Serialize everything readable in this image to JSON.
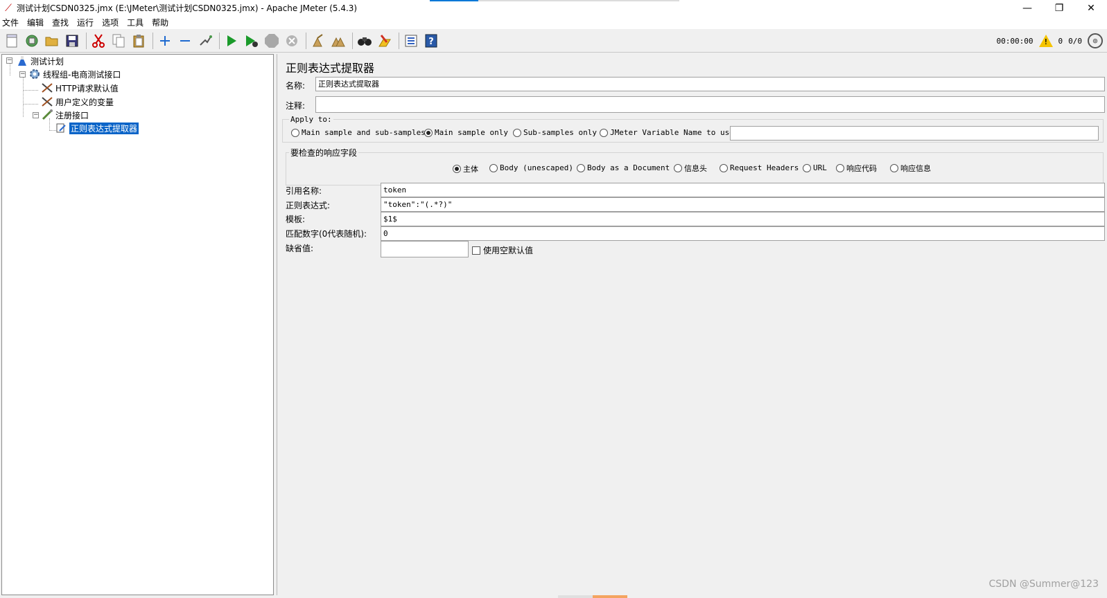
{
  "window": {
    "title": "测试计划CSDN0325.jmx (E:\\JMeter\\测试计划CSDN0325.jmx) - Apache JMeter (5.4.3)",
    "minimize": "—",
    "restore": "❐",
    "close": "✕"
  },
  "menu": [
    "文件",
    "编辑",
    "查找",
    "运行",
    "选项",
    "工具",
    "帮助"
  ],
  "toolbar": {
    "timer": "00:00:00",
    "warning_count": "0",
    "thread_ratio": "0/0",
    "buttons": [
      "new-icon",
      "templates-icon",
      "open-icon",
      "save-icon",
      "cut-icon",
      "copy-icon",
      "paste-icon",
      "expand-icon",
      "collapse-icon",
      "toggle-icon",
      "start-icon",
      "start-no-pause-icon",
      "stop-icon",
      "shutdown-icon",
      "clear-icon",
      "clear-all-icon",
      "search-icon",
      "reset-search-icon",
      "function-helper-icon",
      "help-icon"
    ]
  },
  "tree": {
    "root": "测试计划",
    "thread_group": "线程组-电商测试接口",
    "http_defaults": "HTTP请求默认值",
    "user_vars": "用户定义的变量",
    "register": "注册接口",
    "extractor": "正则表达式提取器"
  },
  "editor": {
    "title": "正则表达式提取器",
    "name_label": "名称:",
    "name_value": "正则表达式提取器",
    "comment_label": "注释:",
    "comment_value": "",
    "apply_to": {
      "title": "Apply to:",
      "options": [
        "Main sample and sub-samples",
        "Main sample only",
        "Sub-samples only",
        "JMeter Variable Name to use"
      ],
      "selected_index": 1,
      "variable_name": ""
    },
    "response_field": {
      "title": "要检查的响应字段",
      "options": [
        "主体",
        "Body (unescaped)",
        "Body as a Document",
        "信息头",
        "Request Headers",
        "URL",
        "响应代码",
        "响应信息"
      ],
      "selected_index": 0
    },
    "ref_name_label": "引用名称:",
    "ref_name_value": "token",
    "regex_label": "正则表达式:",
    "regex_value": "\"token\":\"(.*?)\"",
    "template_label": "模板:",
    "template_value": "$1$",
    "match_no_label": "匹配数字(0代表随机):",
    "match_no_value": "0",
    "default_label": "缺省值:",
    "default_value": "",
    "use_empty_default": "使用空默认值"
  },
  "watermark": "CSDN @Summer@123"
}
